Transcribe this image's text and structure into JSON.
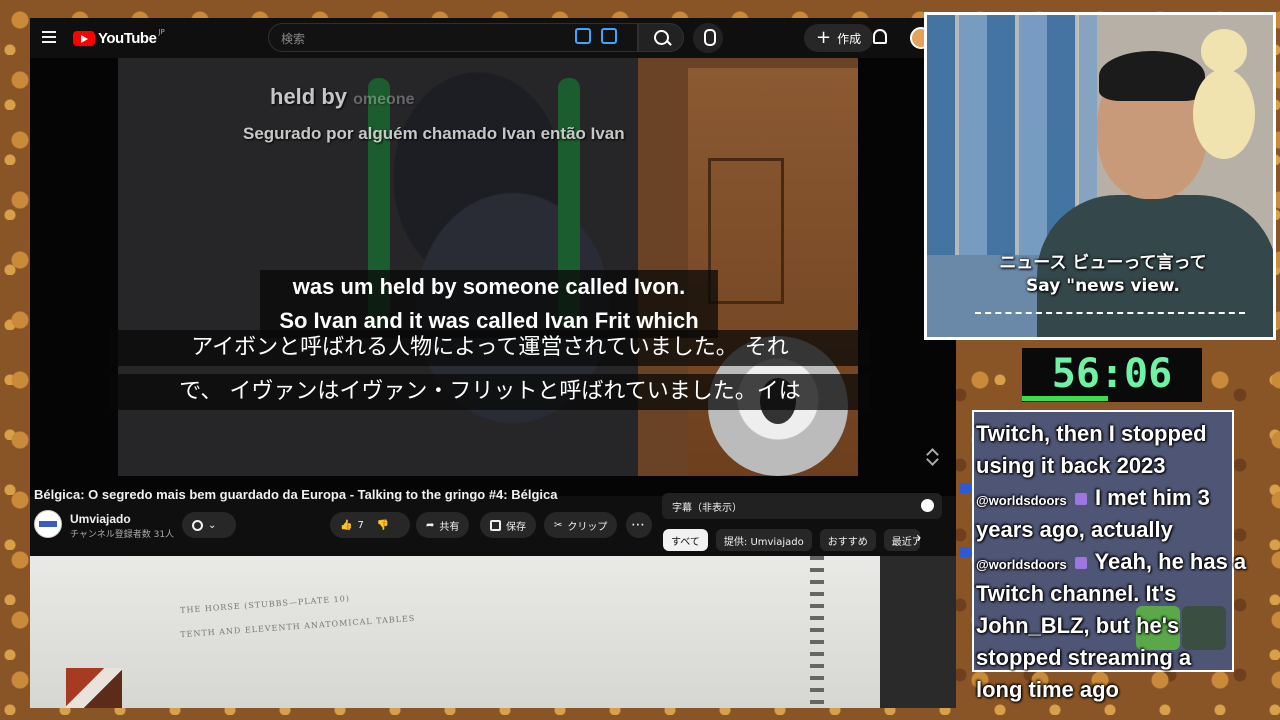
{
  "youtube": {
    "logo_text": "YouTube",
    "logo_region": "JP",
    "search_placeholder": "検索",
    "create_label": "作成",
    "captions": {
      "burned_line1": "held by",
      "burned_line1_faded": "omeone",
      "burned_line2": "Segurado por alguém chamado Ivan então Ivan",
      "english_line1": "was um held by someone called Ivon.",
      "english_line2": "So Ivan and it was called Ivan Frit which",
      "japanese_line1": "アイボンと呼ばれる人物によって運営されていました。 それ",
      "japanese_line2": "で、 イヴァンはイヴァン・フリットと呼ばれていました。イは"
    },
    "video_title": "Bélgica: O segredo mais bem guardado da Europa - Talking to the gringo #4: Bélgica",
    "channel_name": "Umviajado",
    "channel_subs": "チャンネル登録者数 31人",
    "like_count": "7",
    "share_label": "共有",
    "save_label": "保存",
    "clip_label": "クリップ",
    "transcript_title": "字幕（非表示）",
    "chips": [
      "すべて",
      "提供: Umviajado",
      "おすすめ",
      "最近アッ"
    ]
  },
  "webcam": {
    "caption_jp": "ニュース ビューって言って",
    "caption_en": "Say \"news view."
  },
  "timer": "56:06",
  "chat": {
    "line1": "Twitch, then I stopped",
    "line2": "using it back 2023",
    "msg2_user": "@worldsdoors",
    "msg2_line1": "I met him 3",
    "msg2_line2": "years ago, actually",
    "msg3_user": "@worldsdoors",
    "msg3_line1": "Yeah, he has a",
    "msg3_line2": "Twitch channel. It's",
    "msg3_line3": "John_BLZ, but he's",
    "msg3_line4": "stopped streaming a",
    "msg3_line5": "long time ago"
  },
  "colors": {
    "youtube_bg": "#0f0f0f",
    "youtube_red": "#ff0000",
    "timer_green": "#6ef3a6",
    "chat_bg": "#4f5575"
  }
}
